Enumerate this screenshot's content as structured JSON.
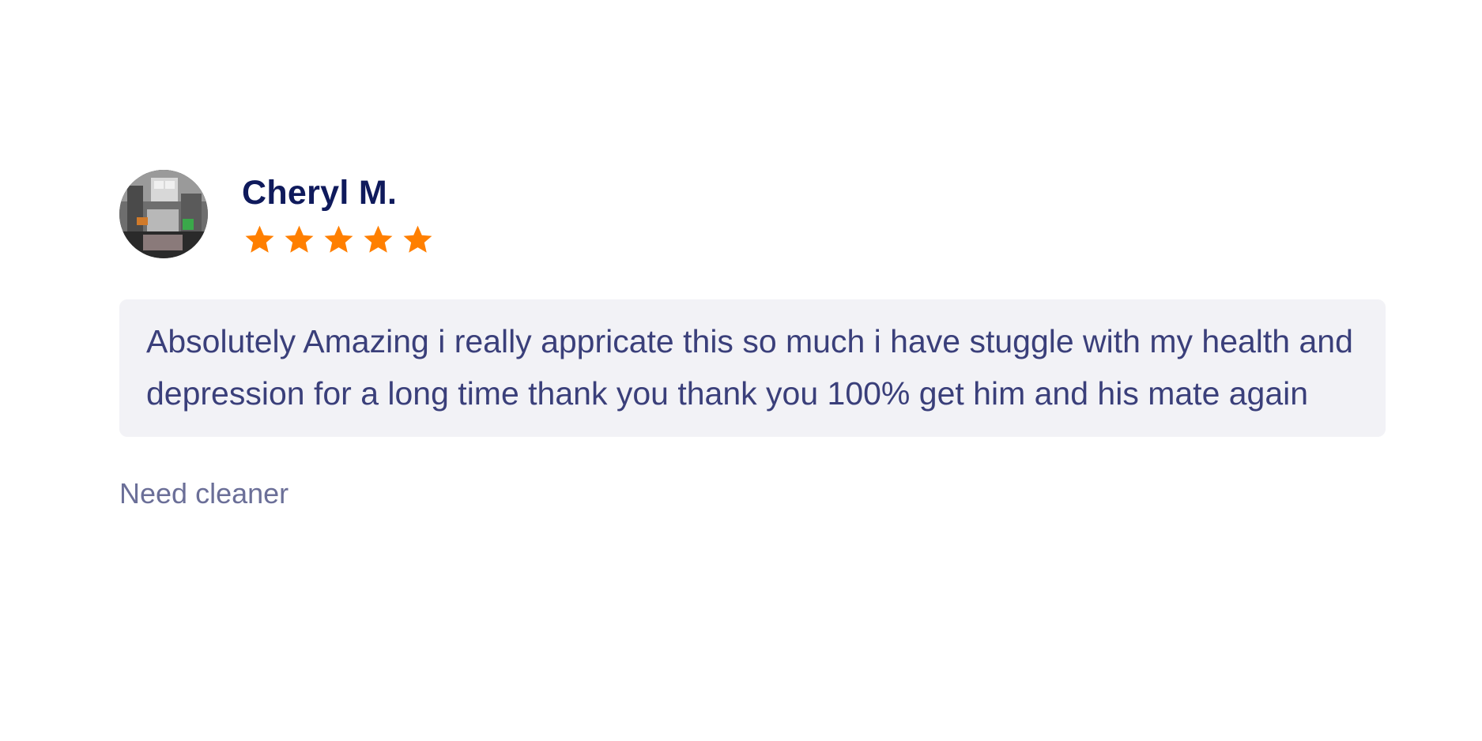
{
  "review": {
    "reviewer_name": "Cheryl M.",
    "avatar_icon": "avatar-photo",
    "rating": 5,
    "max_rating": 5,
    "star_color": "#ff7f00",
    "text": "Absolutely Amazing i really appricate this so much i have stuggle with my health and depression for a long time thank you thank you 100% get him and his mate again",
    "service": "Need cleaner"
  }
}
